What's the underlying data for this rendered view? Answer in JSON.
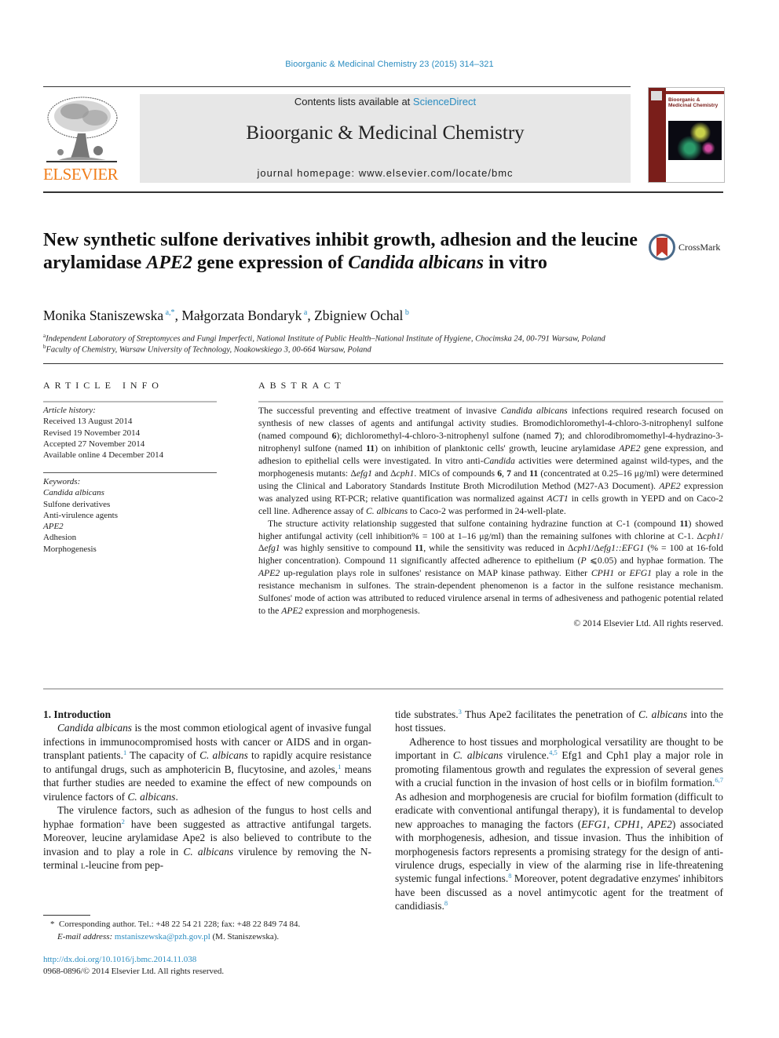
{
  "header": {
    "journal_ref": "Bioorganic & Medicinal Chemistry 23 (2015) 314–321",
    "publisher": "ELSEVIER",
    "contents_prefix": "Contents lists available at ",
    "contents_link": "ScienceDirect",
    "journal_title": "Bioorganic & Medicinal Chemistry",
    "homepage": "journal homepage: www.elsevier.com/locate/bmc",
    "cover_title": "Bioorganic & Medicinal Chemistry"
  },
  "article": {
    "title_parts": [
      {
        "text": "New synthetic sulfone derivatives inhibit growth, adhesion and the leucine arylamidase ",
        "italic": false
      },
      {
        "text": "APE2",
        "italic": true
      },
      {
        "text": " gene expression of ",
        "italic": false
      },
      {
        "text": "Candida albicans",
        "italic": true
      },
      {
        "text": " in vitro",
        "italic": false
      }
    ],
    "crossmark_label": "CrossMark",
    "authors": [
      {
        "name": "Monika Staniszewska",
        "aff": "a,*"
      },
      {
        "name": "Małgorzata Bondaryk",
        "aff": "a"
      },
      {
        "name": "Zbigniew Ochal",
        "aff": "b"
      }
    ],
    "affiliations": [
      {
        "key": "a",
        "text": "Independent Laboratory of Streptomyces and Fungi Imperfecti, National Institute of Public Health–National Institute of Hygiene, Chocimska 24, 00-791 Warsaw, Poland"
      },
      {
        "key": "b",
        "text": "Faculty of Chemistry, Warsaw University of Technology, Noakowskiego 3, 00-664 Warsaw, Poland"
      }
    ]
  },
  "article_info": {
    "label": "ARTICLE INFO",
    "history_heading": "Article history:",
    "history": [
      "Received 13 August 2014",
      "Revised 19 November 2014",
      "Accepted 27 November 2014",
      "Available online 4 December 2014"
    ],
    "keywords_heading": "Keywords:",
    "keywords": [
      {
        "text": "Candida albicans",
        "italic": true
      },
      {
        "text": "Sulfone derivatives",
        "italic": false
      },
      {
        "text": "Anti-virulence agents",
        "italic": false
      },
      {
        "text": "APE2",
        "italic": true
      },
      {
        "text": "Adhesion",
        "italic": false
      },
      {
        "text": "Morphogenesis",
        "italic": false
      }
    ]
  },
  "abstract": {
    "label": "ABSTRACT",
    "paragraphs": [
      [
        {
          "t": "The successful preventing and effective treatment of invasive "
        },
        {
          "t": "Candida albicans",
          "i": true
        },
        {
          "t": " infections required research focused on synthesis of new classes of agents and antifungal activity studies. Bromodichloromethyl-4-chloro-3-nitrophenyl sulfone (named compound "
        },
        {
          "t": "6",
          "b": true
        },
        {
          "t": "); dichloromethyl-4-chloro-3-nitrophenyl sulfone (named "
        },
        {
          "t": "7",
          "b": true
        },
        {
          "t": "); and chlorodibromomethyl-4-hydrazino-3-nitrophenyl sulfone (named "
        },
        {
          "t": "11",
          "b": true
        },
        {
          "t": ") on inhibition of planktonic cells' growth, leucine arylamidase "
        },
        {
          "t": "APE2",
          "i": true
        },
        {
          "t": " gene expression, and adhesion to epithelial cells were investigated. In vitro anti-"
        },
        {
          "t": "Candida",
          "i": true
        },
        {
          "t": " activities were determined against wild-types, and the morphogenesis mutants: Δ"
        },
        {
          "t": "efg1",
          "i": true
        },
        {
          "t": " and Δ"
        },
        {
          "t": "cph1",
          "i": true
        },
        {
          "t": ". MICs of compounds "
        },
        {
          "t": "6",
          "b": true
        },
        {
          "t": ", "
        },
        {
          "t": "7",
          "b": true
        },
        {
          "t": " and "
        },
        {
          "t": "11",
          "b": true
        },
        {
          "t": " (concentrated at 0.25–16 μg/ml) were determined using the Clinical and Laboratory Standards Institute Broth Microdilution Method (M27-A3 Document). "
        },
        {
          "t": "APE2",
          "i": true
        },
        {
          "t": " expression was analyzed using RT-PCR; relative quantification was normalized against "
        },
        {
          "t": "ACT1",
          "i": true
        },
        {
          "t": " in cells growth in YEPD and on Caco-2 cell line. Adherence assay of "
        },
        {
          "t": "C. albicans",
          "i": true
        },
        {
          "t": " to Caco-2 was performed in 24-well-plate."
        }
      ],
      [
        {
          "t": "The structure activity relationship suggested that sulfone containing hydrazine function at C-1 (compound "
        },
        {
          "t": "11",
          "b": true
        },
        {
          "t": ") showed higher antifungal activity (cell inhibition% = 100 at 1–16 μg/ml) than the remaining sulfones with chlorine at C-1. Δ"
        },
        {
          "t": "cph1",
          "i": true
        },
        {
          "t": "/Δ"
        },
        {
          "t": "efg1",
          "i": true
        },
        {
          "t": " was highly sensitive to compound "
        },
        {
          "t": "11",
          "b": true
        },
        {
          "t": ", while the sensitivity was reduced in Δ"
        },
        {
          "t": "cph1",
          "i": true
        },
        {
          "t": "/Δ"
        },
        {
          "t": "efg1::EFG1",
          "i": true
        },
        {
          "t": " (% = 100 at 16-fold higher concentration). Compound 11 significantly affected adherence to epithelium ("
        },
        {
          "t": "P",
          "i": true
        },
        {
          "t": " ⩽0.05) and hyphae formation. The "
        },
        {
          "t": "APE2",
          "i": true
        },
        {
          "t": " up-regulation plays role in sulfones' resistance on MAP kinase pathway. Either "
        },
        {
          "t": "CPH1",
          "i": true
        },
        {
          "t": " or "
        },
        {
          "t": "EFG1",
          "i": true
        },
        {
          "t": " play a role in the resistance mechanism in sulfones. The strain-dependent phenomenon is a factor in the sulfone resistance mechanism. Sulfones' mode of action was attributed to reduced virulence arsenal in terms of adhesiveness and pathogenic potential related to the "
        },
        {
          "t": "APE2",
          "i": true
        },
        {
          "t": " expression and morphogenesis."
        }
      ]
    ],
    "copyright": "© 2014 Elsevier Ltd. All rights reserved."
  },
  "body": {
    "section_heading": "1. Introduction",
    "left_paragraphs": [
      [
        {
          "t": "Candida albicans",
          "i": true
        },
        {
          "t": " is the most common etiological agent of invasive fungal infections in immunocompromised hosts with cancer or AIDS and in organ-transplant patients."
        },
        {
          "t": "1",
          "ref": true
        },
        {
          "t": " The capacity of "
        },
        {
          "t": "C. albicans",
          "i": true
        },
        {
          "t": " to rapidly acquire resistance to antifungal drugs, such as amphotericin B, flucytosine, and azoles,"
        },
        {
          "t": "1",
          "ref": true
        },
        {
          "t": " means that further studies are needed to examine the effect of new compounds on virulence factors of "
        },
        {
          "t": "C. albicans",
          "i": true
        },
        {
          "t": "."
        }
      ],
      [
        {
          "t": "The virulence factors, such as adhesion of the fungus to host cells and hyphae formation"
        },
        {
          "t": "2",
          "ref": true
        },
        {
          "t": " have been suggested as attractive antifungal targets. Moreover, leucine arylamidase Ape2 is also believed to contribute to the invasion and to play a role in "
        },
        {
          "t": "C. albicans",
          "i": true
        },
        {
          "t": " virulence by removing the N-terminal "
        },
        {
          "t": "l",
          "sc": true
        },
        {
          "t": "-leucine from pep-"
        }
      ]
    ],
    "right_paragraphs": [
      [
        {
          "t": "tide substrates."
        },
        {
          "t": "3",
          "ref": true
        },
        {
          "t": " Thus Ape2 facilitates the penetration of "
        },
        {
          "t": "C. albicans",
          "i": true
        },
        {
          "t": " into the host tissues."
        }
      ],
      [
        {
          "t": "Adherence to host tissues and morphological versatility are thought to be important in "
        },
        {
          "t": "C. albicans",
          "i": true
        },
        {
          "t": " virulence."
        },
        {
          "t": "4,5",
          "ref": true
        },
        {
          "t": " Efg1 and Cph1 play a major role in promoting filamentous growth and regulates the expression of several genes with a crucial function in the invasion of host cells or in biofilm formation."
        },
        {
          "t": "6,7",
          "ref": true
        },
        {
          "t": " As adhesion and morphogenesis are crucial for biofilm formation (difficult to eradicate with conventional antifungal therapy), it is fundamental to develop new approaches to managing the factors ("
        },
        {
          "t": "EFG1",
          "i": true
        },
        {
          "t": ", "
        },
        {
          "t": "CPH1",
          "i": true
        },
        {
          "t": ", "
        },
        {
          "t": "APE2",
          "i": true
        },
        {
          "t": ") associated with morphogenesis, adhesion, and tissue invasion. Thus the inhibition of morphogenesis factors represents a promising strategy for the design of anti-virulence drugs, especially in view of the alarming rise in life-threatening systemic fungal infections."
        },
        {
          "t": "8",
          "ref": true
        },
        {
          "t": " Moreover, potent degradative enzymes' inhibitors have been discussed as a novel antimycotic agent for the treatment of candidiasis."
        },
        {
          "t": "8",
          "ref": true
        }
      ]
    ]
  },
  "footnote": {
    "marker": "*",
    "corresponding": "Corresponding author. Tel.: +48 22 54 21 228; fax: +48 22 849 74 84.",
    "email_label": "E-mail address: ",
    "email": "mstaniszewska@pzh.gov.pl",
    "email_suffix": " (M. Staniszewska)."
  },
  "doi": {
    "link": "http://dx.doi.org/10.1016/j.bmc.2014.11.038",
    "issn_line": "0968-0896/© 2014 Elsevier Ltd. All rights reserved."
  },
  "colors": {
    "link": "#2a8cc0",
    "elsevier_orange": "#f07d1a",
    "banner_bg": "#e7e7e7",
    "cover_red": "#7a1e1a",
    "crossmark_red": "#c0392b"
  }
}
